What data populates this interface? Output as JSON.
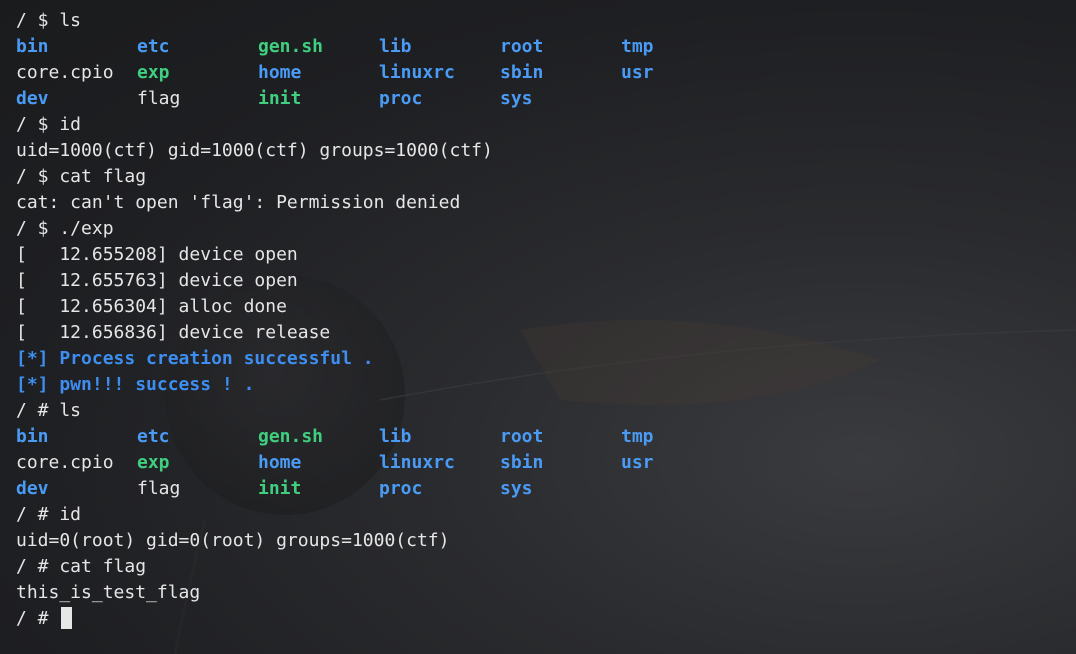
{
  "colors": {
    "directory": "#4a9bf5",
    "executable": "#3fcf7f",
    "file": "#e6e6e6",
    "info": "#3d8ef0",
    "background": "#1e1f22"
  },
  "lines": [
    {
      "type": "text",
      "text": "/ $ ls"
    },
    {
      "type": "grid",
      "cells": [
        {
          "text": "bin",
          "kind": "dir"
        },
        {
          "text": "etc",
          "kind": "dir"
        },
        {
          "text": "gen.sh",
          "kind": "exec"
        },
        {
          "text": "lib",
          "kind": "dir"
        },
        {
          "text": "root",
          "kind": "dir"
        },
        {
          "text": "tmp",
          "kind": "dir"
        }
      ]
    },
    {
      "type": "grid",
      "cells": [
        {
          "text": "core.cpio",
          "kind": "file"
        },
        {
          "text": "exp",
          "kind": "exec"
        },
        {
          "text": "home",
          "kind": "dir"
        },
        {
          "text": "linuxrc",
          "kind": "dir"
        },
        {
          "text": "sbin",
          "kind": "dir"
        },
        {
          "text": "usr",
          "kind": "dir"
        }
      ]
    },
    {
      "type": "grid",
      "cells": [
        {
          "text": "dev",
          "kind": "dir"
        },
        {
          "text": "flag",
          "kind": "file"
        },
        {
          "text": "init",
          "kind": "exec"
        },
        {
          "text": "proc",
          "kind": "dir"
        },
        {
          "text": "sys",
          "kind": "dir"
        }
      ]
    },
    {
      "type": "text",
      "text": "/ $ id"
    },
    {
      "type": "text",
      "text": "uid=1000(ctf) gid=1000(ctf) groups=1000(ctf)"
    },
    {
      "type": "text",
      "text": "/ $ cat flag"
    },
    {
      "type": "text",
      "text": "cat: can't open 'flag': Permission denied"
    },
    {
      "type": "text",
      "text": "/ $ ./exp"
    },
    {
      "type": "text",
      "text": "[   12.655208] device open"
    },
    {
      "type": "text",
      "text": "[   12.655763] device open"
    },
    {
      "type": "text",
      "text": "[   12.656304] alloc done"
    },
    {
      "type": "text",
      "text": "[   12.656836] device release"
    },
    {
      "type": "info",
      "text": "[*] Process creation successful ."
    },
    {
      "type": "info",
      "text": "[*] pwn!!! success ! ."
    },
    {
      "type": "text",
      "text": "/ # ls"
    },
    {
      "type": "grid",
      "cells": [
        {
          "text": "bin",
          "kind": "dir"
        },
        {
          "text": "etc",
          "kind": "dir"
        },
        {
          "text": "gen.sh",
          "kind": "exec"
        },
        {
          "text": "lib",
          "kind": "dir"
        },
        {
          "text": "root",
          "kind": "dir"
        },
        {
          "text": "tmp",
          "kind": "dir"
        }
      ]
    },
    {
      "type": "grid",
      "cells": [
        {
          "text": "core.cpio",
          "kind": "file"
        },
        {
          "text": "exp",
          "kind": "exec"
        },
        {
          "text": "home",
          "kind": "dir"
        },
        {
          "text": "linuxrc",
          "kind": "dir"
        },
        {
          "text": "sbin",
          "kind": "dir"
        },
        {
          "text": "usr",
          "kind": "dir"
        }
      ]
    },
    {
      "type": "grid",
      "cells": [
        {
          "text": "dev",
          "kind": "dir"
        },
        {
          "text": "flag",
          "kind": "file"
        },
        {
          "text": "init",
          "kind": "exec"
        },
        {
          "text": "proc",
          "kind": "dir"
        },
        {
          "text": "sys",
          "kind": "dir"
        }
      ]
    },
    {
      "type": "text",
      "text": "/ # id"
    },
    {
      "type": "text",
      "text": "uid=0(root) gid=0(root) groups=1000(ctf)"
    },
    {
      "type": "text",
      "text": "/ # cat flag"
    },
    {
      "type": "text",
      "text": "this_is_test_flag"
    },
    {
      "type": "prompt",
      "text": "/ # "
    }
  ]
}
